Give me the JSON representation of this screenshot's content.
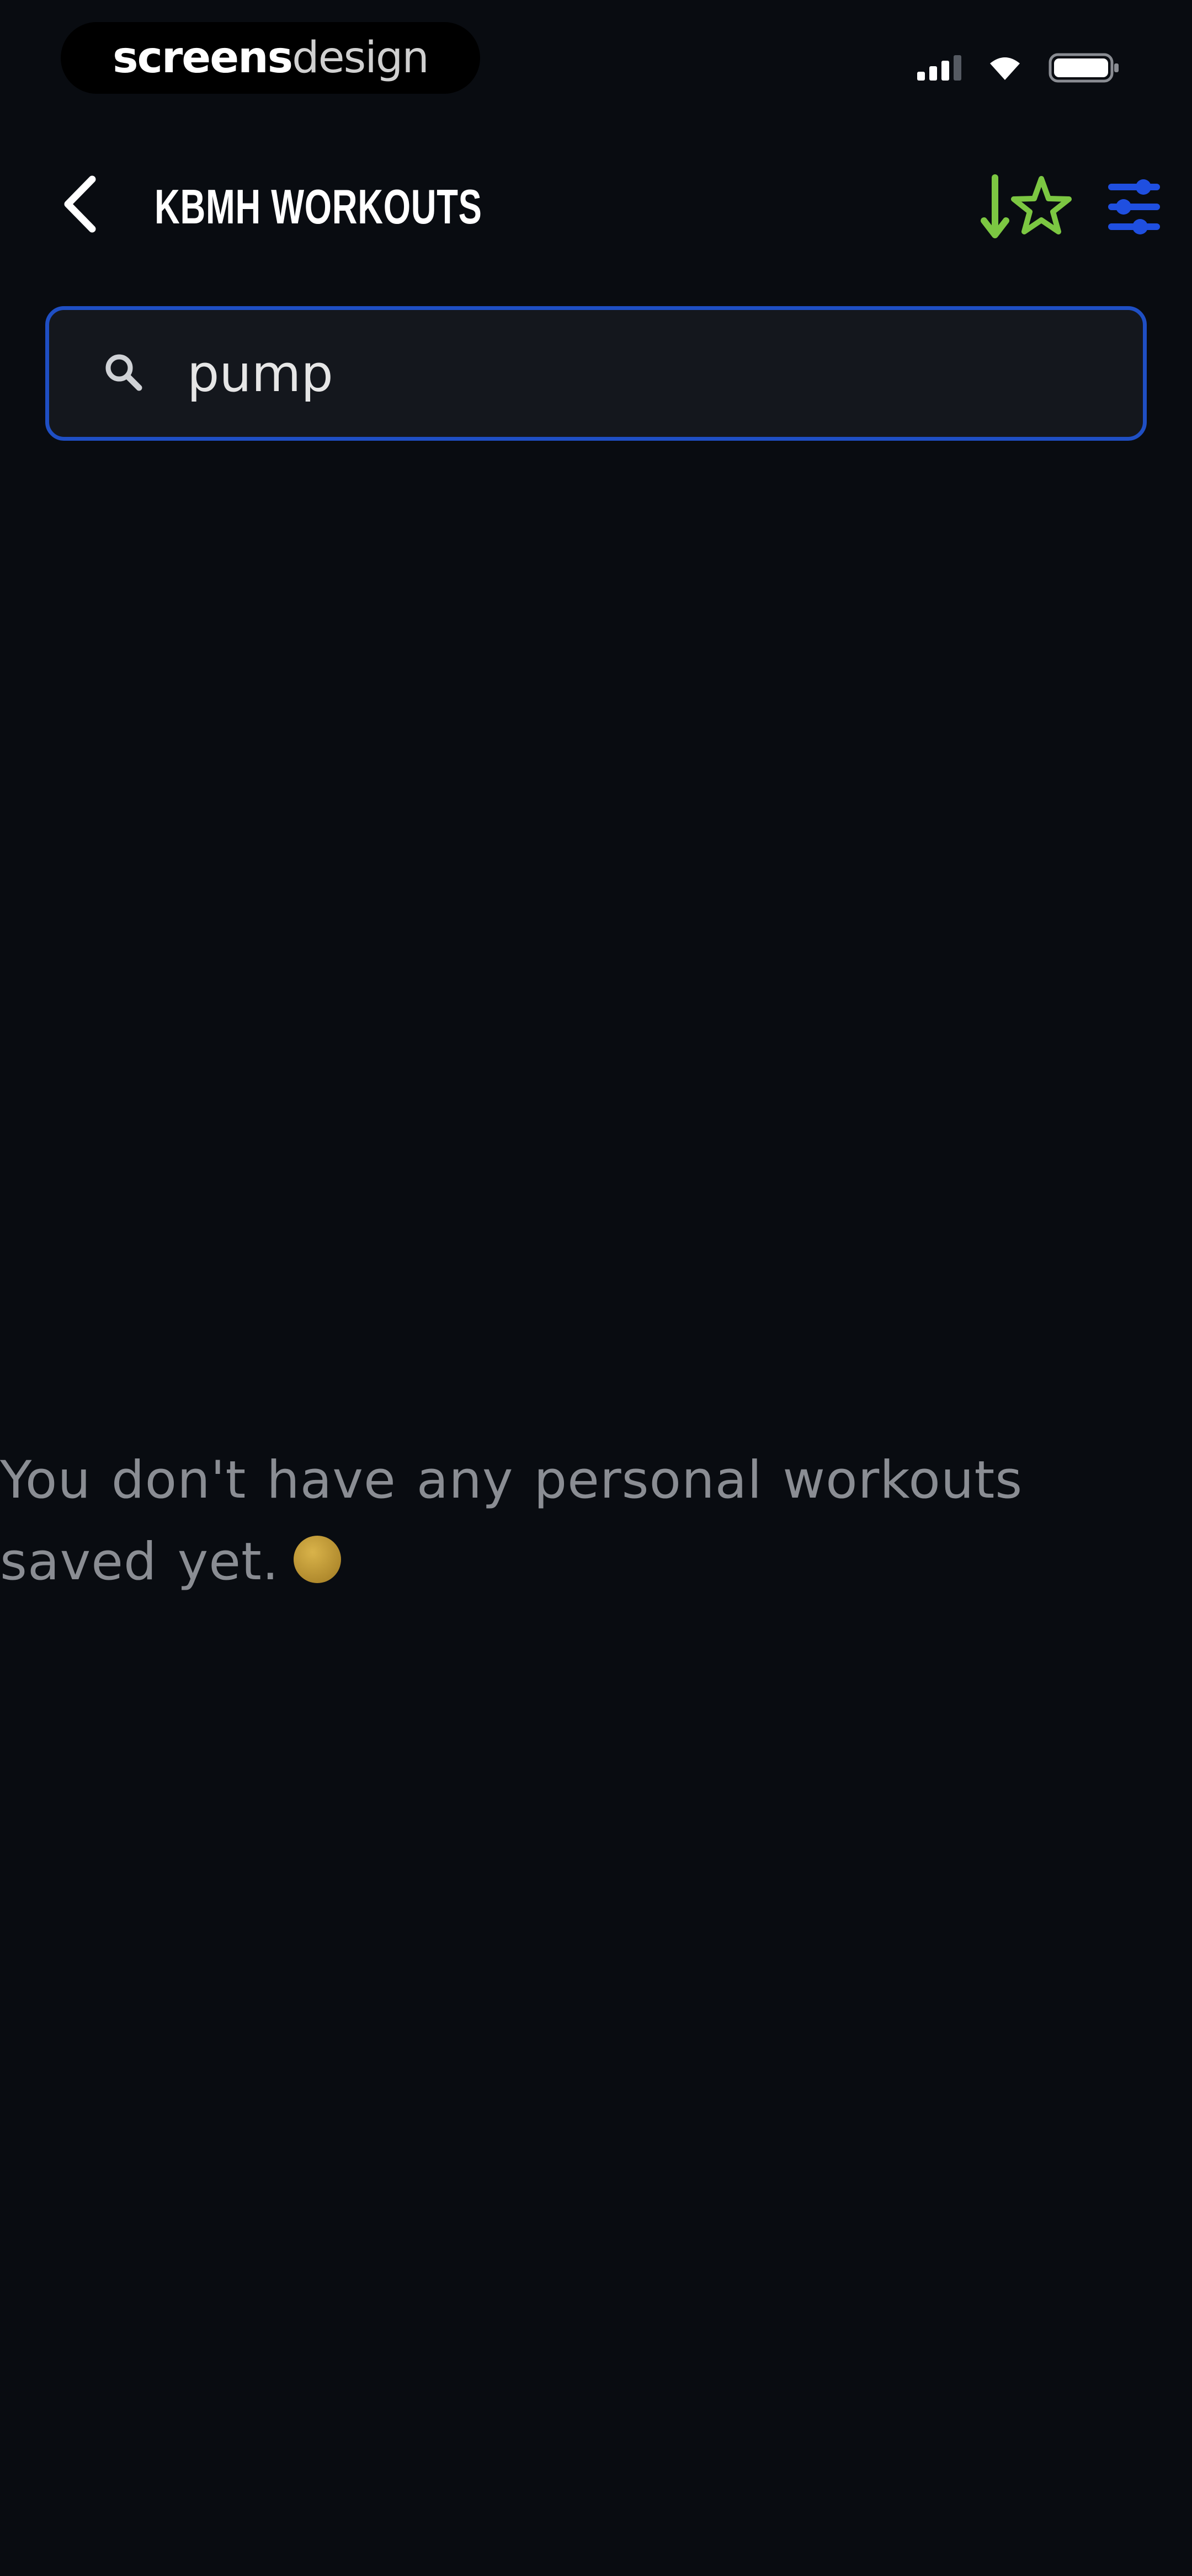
{
  "status_bar": {
    "brand_strong": "screens",
    "brand_light": "design",
    "icons": [
      "cellular-signal-icon",
      "wifi-icon",
      "battery-icon"
    ]
  },
  "nav": {
    "title": "KBMH WORKOUTS",
    "icons": [
      "back-chevron-icon",
      "sort-favorites-icon",
      "filter-sliders-icon"
    ]
  },
  "search": {
    "value": "pump",
    "placeholder": ""
  },
  "empty_state": {
    "message": "You don't have any personal workouts saved yet."
  },
  "colors": {
    "background": "#090c11",
    "search_border": "#1f4fc4",
    "search_background": "#14171d",
    "favorites_icon": "#7cc742",
    "filter_icon": "#1f4fe0",
    "muted_text": "#8a8d93"
  }
}
